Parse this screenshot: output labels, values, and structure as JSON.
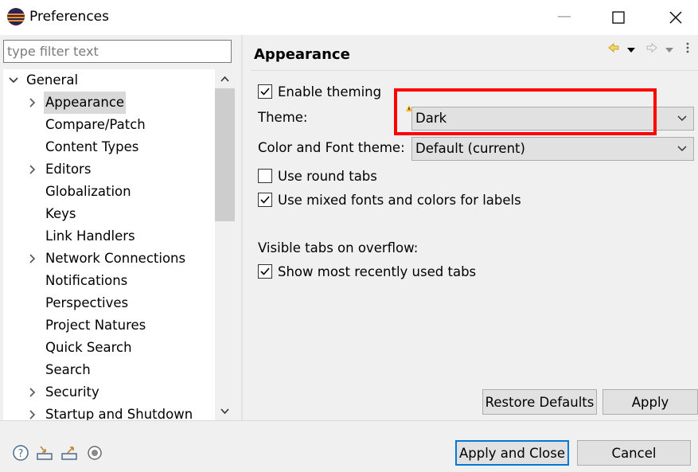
{
  "window": {
    "title": "Preferences",
    "min_glyph": "—",
    "max_glyph": "☐",
    "close_glyph": "✕"
  },
  "filter": {
    "placeholder": "type filter text",
    "value": ""
  },
  "tree": {
    "items": [
      {
        "label": "General",
        "level": 0,
        "expander": "expanded"
      },
      {
        "label": "Appearance",
        "level": 1,
        "expander": "collapsed",
        "selected": true
      },
      {
        "label": "Compare/Patch",
        "level": 1,
        "expander": "none"
      },
      {
        "label": "Content Types",
        "level": 1,
        "expander": "none"
      },
      {
        "label": "Editors",
        "level": 1,
        "expander": "collapsed"
      },
      {
        "label": "Globalization",
        "level": 1,
        "expander": "none"
      },
      {
        "label": "Keys",
        "level": 1,
        "expander": "none"
      },
      {
        "label": "Link Handlers",
        "level": 1,
        "expander": "none"
      },
      {
        "label": "Network Connections",
        "level": 1,
        "expander": "collapsed"
      },
      {
        "label": "Notifications",
        "level": 1,
        "expander": "none"
      },
      {
        "label": "Perspectives",
        "level": 1,
        "expander": "none"
      },
      {
        "label": "Project Natures",
        "level": 1,
        "expander": "none"
      },
      {
        "label": "Quick Search",
        "level": 1,
        "expander": "none"
      },
      {
        "label": "Search",
        "level": 1,
        "expander": "none"
      },
      {
        "label": "Security",
        "level": 1,
        "expander": "collapsed"
      },
      {
        "label": "Startup and Shutdown",
        "level": 1,
        "expander": "collapsed"
      }
    ]
  },
  "page": {
    "title": "Appearance",
    "enable_theming": {
      "label": "Enable theming",
      "checked": true
    },
    "theme_label": "Theme:",
    "theme_value": "Dark",
    "color_font_label": "Color and Font theme:",
    "color_font_value": "Default (current)",
    "round_tabs": {
      "label": "Use round tabs",
      "checked": false
    },
    "mixed_fonts": {
      "label": "Use mixed fonts and colors for labels",
      "checked": true
    },
    "overflow_label": "Visible tabs on overflow:",
    "mru_tabs": {
      "label": "Show most recently used tabs",
      "checked": true
    },
    "restore_defaults": "Restore Defaults",
    "apply": "Apply"
  },
  "footer": {
    "apply_close": "Apply and Close",
    "cancel": "Cancel"
  },
  "colors": {
    "highlight": "#ff0000",
    "default_button_border": "#0078d7",
    "selection": "#d9d9d9"
  }
}
